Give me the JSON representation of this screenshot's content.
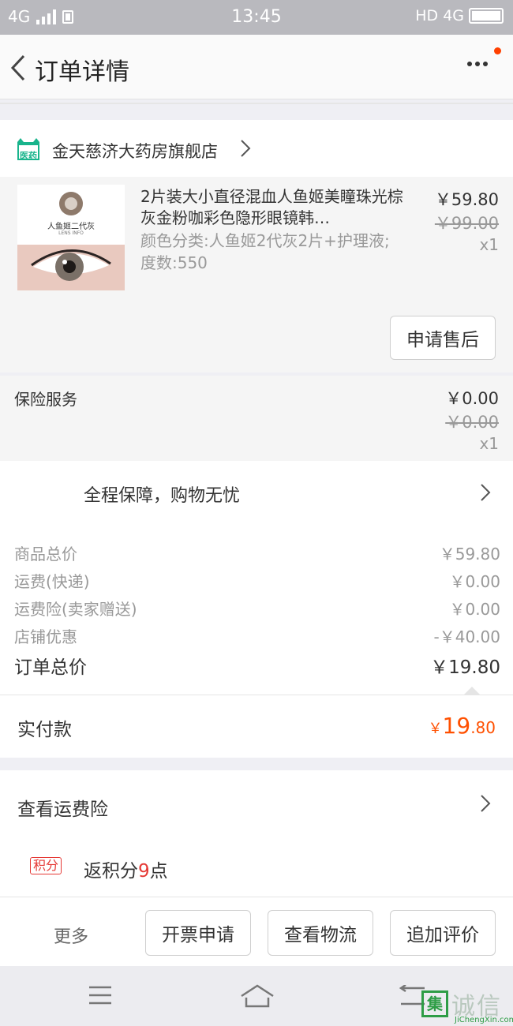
{
  "status_bar": {
    "network": "4G",
    "time": "13:45",
    "hd": "HD",
    "network_right": "4G"
  },
  "nav": {
    "title": "订单详情",
    "more_icon": "more-dots-icon",
    "notification_color": "#ff4000"
  },
  "store": {
    "icon_label": "医药",
    "name": "金天慈济大药房旗舰店"
  },
  "product": {
    "thumb_label": "人鱼姬二代灰",
    "thumb_sub": "LENS INFO",
    "title": "2片装大小直径混血人鱼姬美瞳珠光棕灰金粉咖彩色隐形眼镜韩…",
    "sku": "颜色分类:人鱼姬2代灰2片+护理液;度数:550",
    "price": "￥59.80",
    "original_price": "￥99.00",
    "quantity": "x1",
    "after_sale_label": "申请售后"
  },
  "insurance": {
    "label": "保险服务",
    "price": "￥0.00",
    "original_price": "￥0.00",
    "quantity": "x1"
  },
  "guarantee": {
    "text": "全程保障，购物无忧"
  },
  "summary": {
    "rows": [
      {
        "label": "商品总价",
        "value": "￥59.80"
      },
      {
        "label": "运费(快递)",
        "value": "￥0.00"
      },
      {
        "label": "运费险(卖家赠送)",
        "value": "￥0.00"
      },
      {
        "label": "店铺优惠",
        "value": "-￥40.00"
      }
    ],
    "total_label": "订单总价",
    "total_value": "￥19.80"
  },
  "paid": {
    "label": "实付款",
    "currency": "￥",
    "integer": "19",
    "decimal": ".80",
    "accent_color": "#ff5000"
  },
  "freight": {
    "label": "查看运费险",
    "points_badge": "积分",
    "points_prefix": "返积分",
    "points_value": "9",
    "points_suffix": "点"
  },
  "actions": {
    "more": "更多",
    "invoice": "开票申请",
    "logistics": "查看物流",
    "review": "追加评价"
  },
  "watermark": {
    "box": "集",
    "text": "诚信",
    "sub": "JiChengXin.com"
  }
}
